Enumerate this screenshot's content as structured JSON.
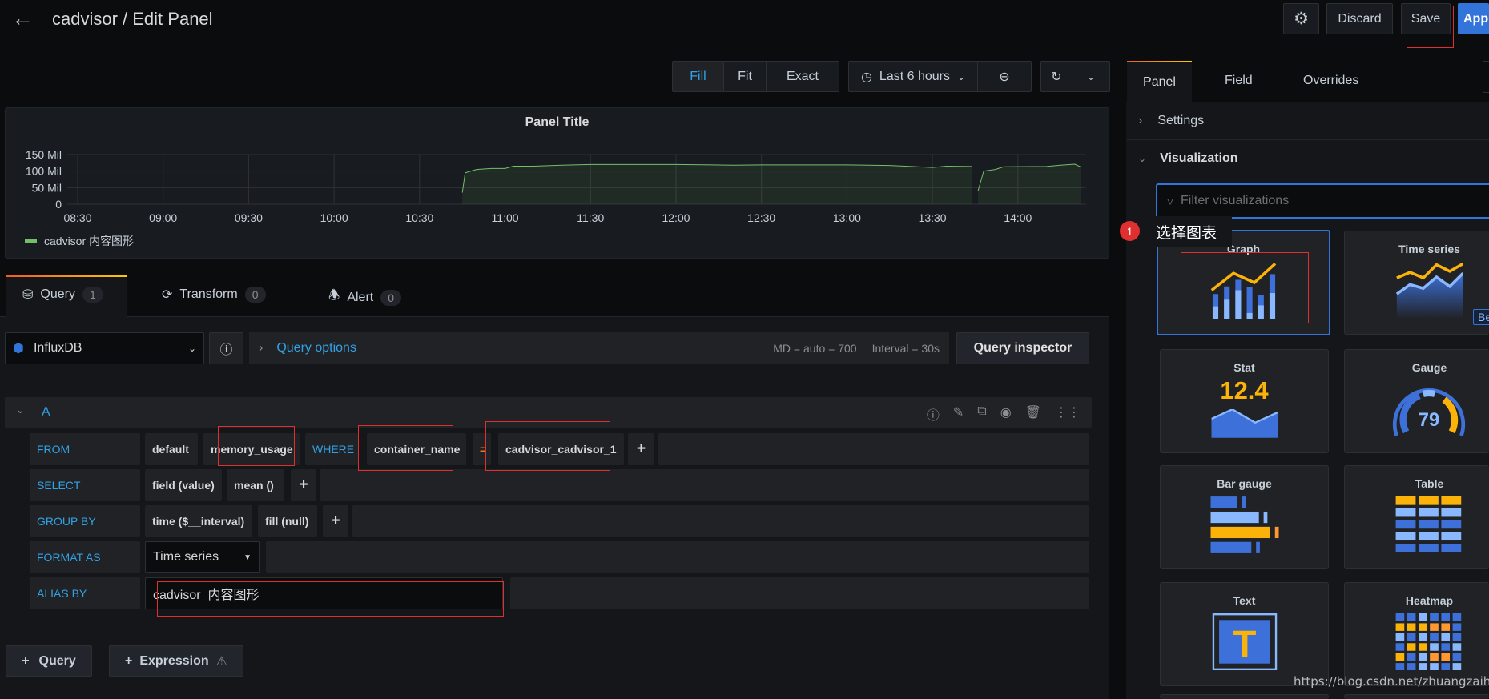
{
  "header": {
    "title": "cadvisor / Edit Panel",
    "discard_label": "Discard",
    "save_label": "Save",
    "apply_label": "Apply"
  },
  "toolbar": {
    "fill": "Fill",
    "fit": "Fit",
    "exact": "Exact",
    "time_range": "Last 6 hours"
  },
  "panel": {
    "title": "Panel Title",
    "legend": "cadvisor 内容图形"
  },
  "chart_data": {
    "type": "area",
    "title": "Panel Title",
    "x_ticks": [
      "08:30",
      "09:00",
      "09:30",
      "10:00",
      "10:30",
      "11:00",
      "11:30",
      "12:00",
      "12:30",
      "13:00",
      "13:30",
      "14:00"
    ],
    "y_ticks": [
      "150 Mil",
      "100 Mil",
      "50 Mil",
      "0"
    ],
    "ylim": [
      0,
      150000000
    ],
    "xlim": [
      "08:26",
      "14:24"
    ],
    "grid": true,
    "legend_position": "bottom-left",
    "series": [
      {
        "name": "cadvisor 内容图形",
        "color": "#73bf69",
        "points": [
          [
            "10:45",
            35000000
          ],
          [
            "10:46",
            95000000
          ],
          [
            "10:50",
            105000000
          ],
          [
            "10:55",
            108000000
          ],
          [
            "11:00",
            108000000
          ],
          [
            "11:03",
            115000000
          ],
          [
            "11:10",
            115000000
          ],
          [
            "11:20",
            118000000
          ],
          [
            "11:30",
            120000000
          ],
          [
            "12:00",
            120000000
          ],
          [
            "12:20",
            118000000
          ],
          [
            "12:30",
            119000000
          ],
          [
            "13:00",
            119000000
          ],
          [
            "13:15",
            117000000
          ],
          [
            "13:30",
            111000000
          ],
          [
            "13:35",
            115000000
          ],
          [
            "13:44",
            114000000
          ],
          null,
          [
            "13:46",
            40000000
          ],
          [
            "13:48",
            100000000
          ],
          [
            "13:52",
            105000000
          ],
          [
            "13:55",
            113000000
          ],
          [
            "14:10",
            114000000
          ],
          [
            "14:15",
            118000000
          ],
          [
            "14:20",
            121000000
          ],
          [
            "14:22",
            113000000
          ]
        ]
      }
    ]
  },
  "tabs": [
    {
      "label": "Query",
      "count": "1"
    },
    {
      "label": "Transform",
      "count": "0"
    },
    {
      "label": "Alert",
      "count": "0"
    }
  ],
  "datasource": {
    "name": "InfluxDB",
    "query_options": "Query options",
    "md": "MD = auto = 700",
    "interval": "Interval = 30s",
    "inspector": "Query inspector"
  },
  "query": {
    "ref": "A",
    "from_label": "FROM",
    "from_policy": "default",
    "from_measurement": "memory_usage",
    "where_label": "WHERE",
    "where_key": "container_name",
    "where_op": "=",
    "where_value": "cadvisor_cadvisor_1",
    "select_label": "SELECT",
    "select_field": "field (value)",
    "select_fn": "mean ()",
    "group_label": "GROUP BY",
    "group_time": "time ($__interval)",
    "group_fill": "fill (null)",
    "format_label": "FORMAT AS",
    "format_value": "Time series",
    "alias_label": "ALIAS BY",
    "alias_value": "cadvisor  内容图形"
  },
  "add": {
    "query": "Query",
    "expression": "Expression"
  },
  "options": {
    "tabs": [
      "Panel",
      "Field",
      "Overrides"
    ],
    "settings": "Settings",
    "visualization": "Visualization",
    "filter_placeholder": "Filter visualizations",
    "tooltip_step": "1",
    "tooltip_text": "选择图表",
    "cards": [
      {
        "label": "Graph"
      },
      {
        "label": "Time series",
        "badge": "Beta"
      },
      {
        "label": "Stat",
        "value": "12.4"
      },
      {
        "label": "Gauge",
        "value": "79"
      },
      {
        "label": "Bar gauge"
      },
      {
        "label": "Table"
      },
      {
        "label": "Text",
        "value": "T"
      },
      {
        "label": "Heatmap"
      }
    ]
  },
  "watermark": "https://blog.csdn.net/zhuangzaihe",
  "colors": {
    "accent": "#3274d9",
    "link": "#33a2e5",
    "series": "#73bf69",
    "annotation": "#e02f2f"
  }
}
